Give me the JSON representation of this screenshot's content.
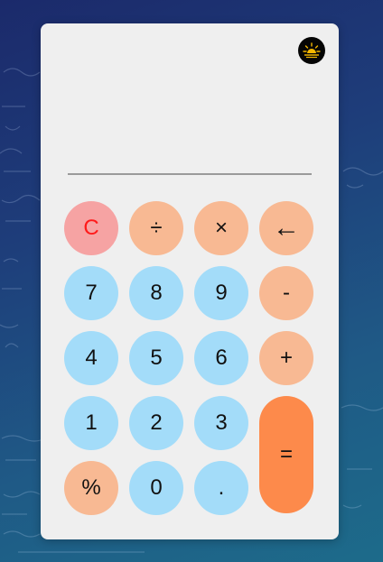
{
  "calculator": {
    "display_value": "",
    "theme_icon": "sun-icon",
    "colors": {
      "number_key": "#a3dcf9",
      "operator_key": "#f8b993",
      "clear_key": "#f6a3a3",
      "clear_text": "#ff1a1a",
      "equals_key": "#fd8a4b",
      "panel": "#efefef"
    },
    "keys": {
      "clear": "C",
      "divide": "÷",
      "multiply": "×",
      "backspace": "←",
      "seven": "7",
      "eight": "8",
      "nine": "9",
      "minus": "-",
      "four": "4",
      "five": "5",
      "six": "6",
      "plus": "+",
      "one": "1",
      "two": "2",
      "three": "3",
      "equals": "=",
      "percent": "%",
      "zero": "0",
      "decimal": "."
    }
  }
}
